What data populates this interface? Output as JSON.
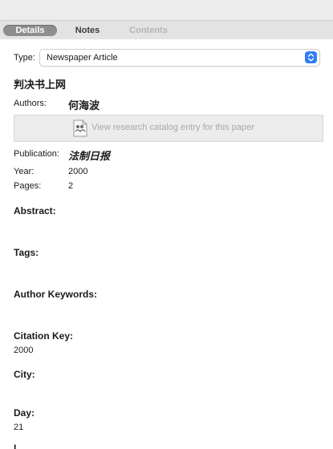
{
  "tabs": [
    {
      "label": "Details"
    },
    {
      "label": "Notes"
    },
    {
      "label": "Contents"
    }
  ],
  "type_field": {
    "label": "Type:",
    "value": "Newspaper Article"
  },
  "item_title": "判决书上网",
  "authors": {
    "label": "Authors:",
    "value": "何海波"
  },
  "catalog_button": {
    "label": "View research catalog entry for this paper"
  },
  "publication": {
    "label": "Publication:",
    "value": "法制日报"
  },
  "year": {
    "label": "Year:",
    "value": "2000"
  },
  "pages": {
    "label": "Pages:",
    "value": "2"
  },
  "sections": {
    "abstract": "Abstract:",
    "tags": "Tags:",
    "author_keywords": "Author Keywords:",
    "citation_key": "Citation Key:",
    "city": "City:",
    "day": "Day:",
    "next_partial": "L"
  },
  "citation_key_value": "2000",
  "day_value": "21",
  "colors": {
    "accent": "#2f7df6",
    "active_tab": "#8e8e8e"
  }
}
